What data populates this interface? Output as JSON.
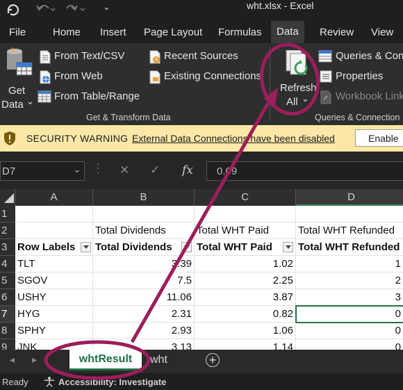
{
  "titlebar": {
    "title": "wht.xlsx  -  Excel"
  },
  "tabs": [
    {
      "label": "File"
    },
    {
      "label": "Home"
    },
    {
      "label": "Insert"
    },
    {
      "label": "Page Layout"
    },
    {
      "label": "Formulas"
    },
    {
      "label": "Data"
    },
    {
      "label": "Review"
    },
    {
      "label": "View"
    }
  ],
  "ribbon": {
    "get_data": {
      "line1": "Get",
      "line2": "Data",
      "chevron": "⌄"
    },
    "from_text_csv": "From Text/CSV",
    "from_web": "From Web",
    "from_table_range": "From Table/Range",
    "recent_sources": "Recent Sources",
    "existing_connections": "Existing Connections",
    "group_get_transform": "Get & Transform Data",
    "refresh": {
      "line1": "Refresh",
      "line2": "All",
      "chevron": "⌄"
    },
    "queries_connections": "Queries & Con",
    "properties": "Properties",
    "workbook_links": "Workbook Link",
    "group_queries": "Queries & Connection"
  },
  "security_bar": {
    "label": "SECURITY WARNING",
    "message": "External Data Connections have been disabled",
    "enable_button": "Enable"
  },
  "formula_bar": {
    "name_box": "D7",
    "cancel": "✕",
    "enter": "✓",
    "fx": "fx",
    "value": "0.09"
  },
  "grid": {
    "columns": [
      "A",
      "B",
      "C",
      "D"
    ],
    "rows": [
      "1",
      "2",
      "3",
      "4",
      "5",
      "6",
      "7",
      "8",
      "9"
    ],
    "row2": {
      "b": "Total Dividends",
      "c": "Total WHT Paid",
      "d": "Total WHT Refunded"
    },
    "row3": {
      "a": "Row Labels",
      "b": "Total Dividends",
      "c": "Total WHT Paid",
      "d": "Total WHT Refunded"
    },
    "data": [
      {
        "label": "TLT",
        "div": "3.39",
        "wht": "1.02",
        "ref": "1"
      },
      {
        "label": "SGOV",
        "div": "7.5",
        "wht": "2.25",
        "ref": "2"
      },
      {
        "label": "USHY",
        "div": "11.06",
        "wht": "3.87",
        "ref": "3"
      },
      {
        "label": "HYG",
        "div": "2.31",
        "wht": "0.82",
        "ref": "0"
      },
      {
        "label": "SPHY",
        "div": "2.93",
        "wht": "1.06",
        "ref": "0"
      },
      {
        "label": "JNK",
        "div": "3.13",
        "wht": "1.14",
        "ref": "0"
      }
    ]
  },
  "sheet_tabs": {
    "active": "whtResult",
    "other": "wht",
    "add": "+"
  },
  "status": {
    "ready": "Ready",
    "accessibility": "Accessibility: Investigate"
  },
  "colors": {
    "accent_annotation": "#9c1e5a",
    "excel_green": "#217346"
  }
}
